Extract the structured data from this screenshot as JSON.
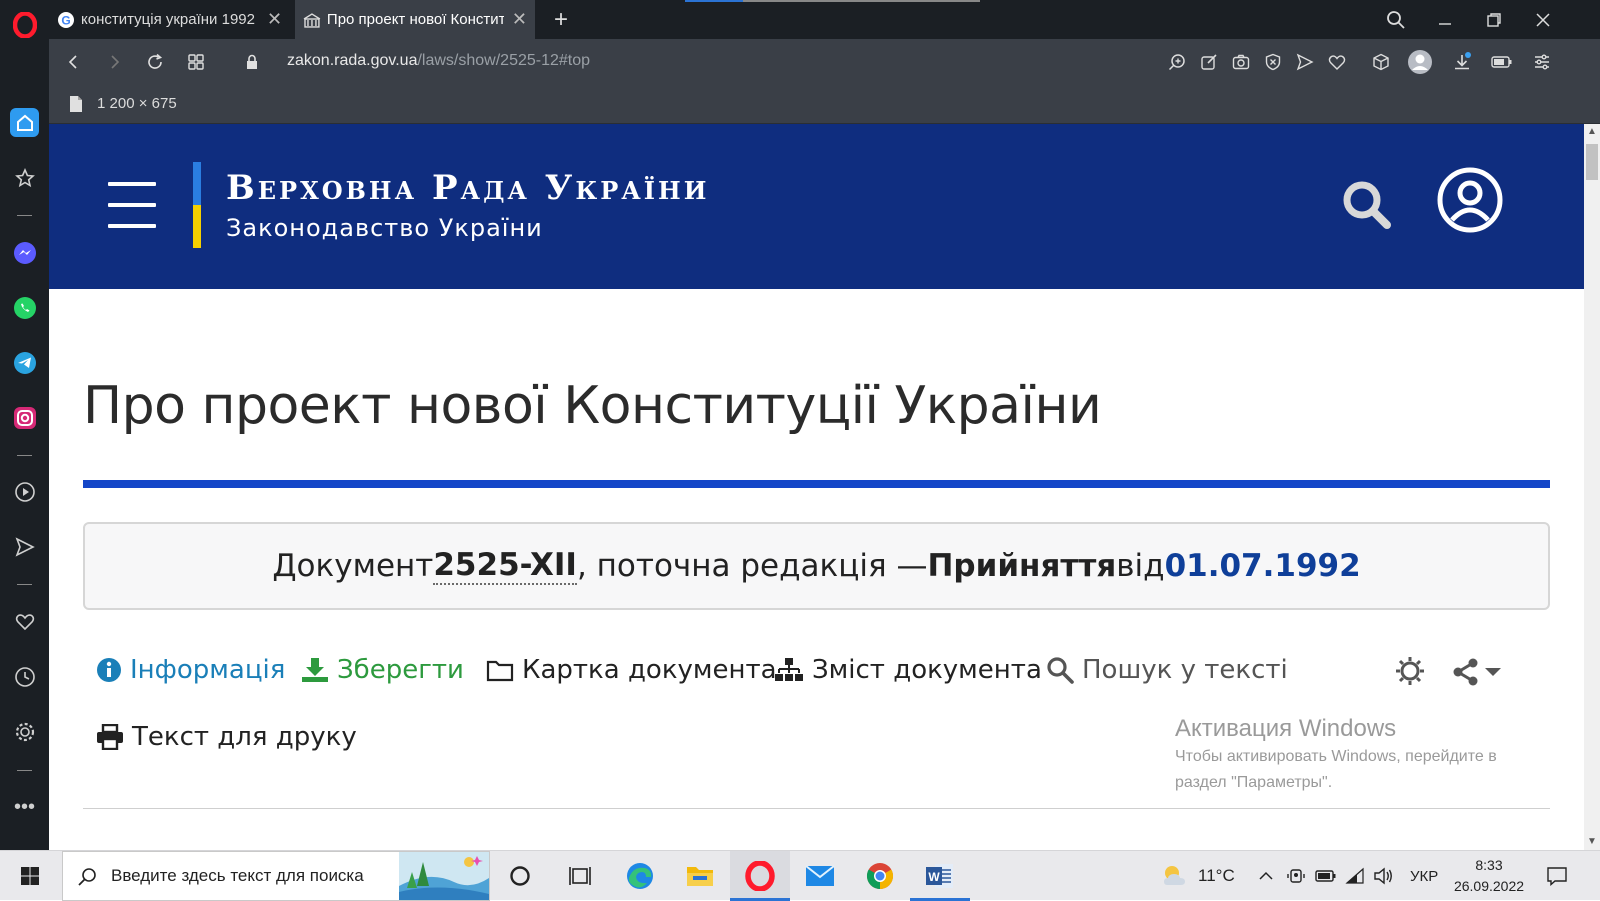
{
  "browser": {
    "tabs": [
      {
        "title": "конституція україни 1992"
      },
      {
        "title": "Про проект нової Конститу"
      }
    ],
    "url": {
      "host": "zakon.rada.gov.ua",
      "path": "/laws/show/2525-12#top"
    },
    "image_info": "1 200 × 675"
  },
  "site": {
    "title": "Верховна Рада України",
    "subtitle": "Законодавство України"
  },
  "page": {
    "heading": "Про проект нової Конституції України",
    "doc_prefix": "Документ ",
    "doc_number": "2525-XII",
    "doc_middle": ", поточна редакція — ",
    "doc_status": "Прийняття",
    "doc_from": " від ",
    "doc_date": "01.07.1992"
  },
  "toolbar": {
    "info": "Інформація",
    "save": "Зберегти",
    "card": "Картка документа",
    "contents": "Зміст документа",
    "search": "Пошук у тексті",
    "print": "Текст для друку"
  },
  "activation": {
    "title": "Активация Windows",
    "line1": "Чтобы активировать Windows, перейдите в",
    "line2": "раздел \"Параметры\"."
  },
  "taskbar": {
    "search_placeholder": "Введите здесь текст для поиска",
    "weather": "11°C",
    "language": "УКР",
    "time": "8:33",
    "date": "26.09.2022"
  },
  "colors": {
    "header_bg": "#0f2d7f",
    "accent_blue": "#1446c8",
    "info_link": "#1a7fb8",
    "save_link": "#2d9a3e",
    "date_color": "#0f3f99"
  }
}
